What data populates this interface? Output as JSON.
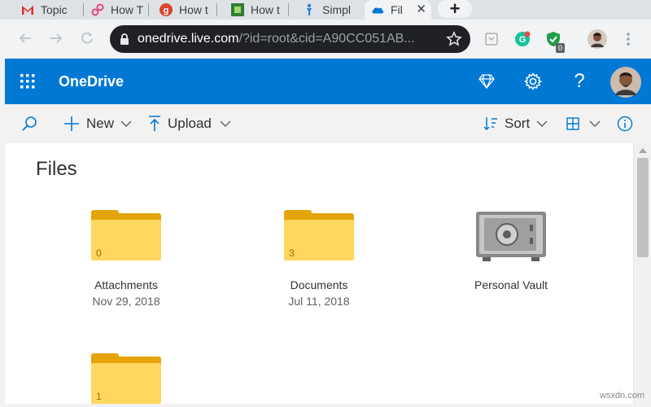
{
  "browser": {
    "tabs": [
      {
        "title": "Topic",
        "icon": "gmail-icon"
      },
      {
        "title": "How T",
        "icon": "link-icon"
      },
      {
        "title": "How t",
        "icon": "g-logo-icon"
      },
      {
        "title": "How t",
        "icon": "green-square-icon"
      },
      {
        "title": "Simpl",
        "icon": "pin-icon"
      },
      {
        "title": "Fil",
        "icon": "onedrive-icon",
        "close": "✕"
      }
    ],
    "new_tab": "+",
    "url_host": "onedrive.live.com",
    "url_path": "/?id=root&cid=A90CC051AB...",
    "ext_badge": "0"
  },
  "header": {
    "app_title": "OneDrive",
    "accent": "#0078d4"
  },
  "commands": {
    "new_label": "New",
    "upload_label": "Upload",
    "sort_label": "Sort"
  },
  "main": {
    "title": "Files",
    "items": [
      {
        "name": "Attachments",
        "date": "Nov 29, 2018",
        "count": "0",
        "type": "folder"
      },
      {
        "name": "Documents",
        "date": "Jul 11, 2018",
        "count": "3",
        "type": "folder"
      },
      {
        "name": "Personal Vault",
        "date": "",
        "type": "vault"
      },
      {
        "name": "",
        "date": "",
        "count": "1",
        "type": "folder"
      }
    ]
  },
  "watermark": "wsxdn.com"
}
